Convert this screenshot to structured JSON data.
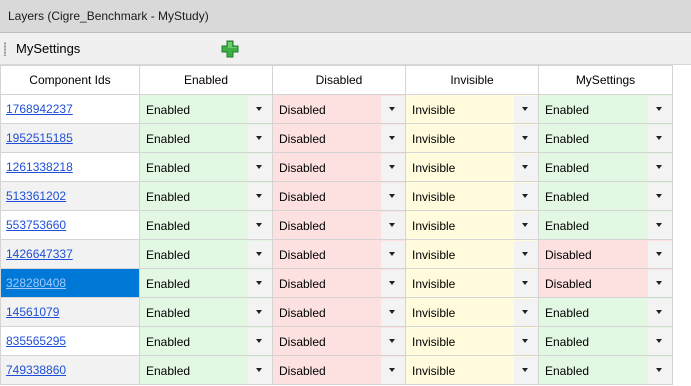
{
  "window": {
    "title": "Layers (Cigre_Benchmark - MyStudy)"
  },
  "toolbar": {
    "layer_name": "MySettings",
    "add_icon": "green-plus-icon",
    "add_color": "#3cb043"
  },
  "grid": {
    "columns": [
      "Component Ids",
      "Enabled",
      "Disabled",
      "Invisible",
      "MySettings"
    ],
    "selected_row": 6,
    "rows": [
      {
        "id": "1768942237",
        "enabled": "Enabled",
        "disabled": "Disabled",
        "invisible": "Invisible",
        "mysettings": "Enabled"
      },
      {
        "id": "1952515185",
        "enabled": "Enabled",
        "disabled": "Disabled",
        "invisible": "Invisible",
        "mysettings": "Enabled"
      },
      {
        "id": "1261338218",
        "enabled": "Enabled",
        "disabled": "Disabled",
        "invisible": "Invisible",
        "mysettings": "Enabled"
      },
      {
        "id": "513361202",
        "enabled": "Enabled",
        "disabled": "Disabled",
        "invisible": "Invisible",
        "mysettings": "Enabled"
      },
      {
        "id": "553753660",
        "enabled": "Enabled",
        "disabled": "Disabled",
        "invisible": "Invisible",
        "mysettings": "Enabled"
      },
      {
        "id": "1426647337",
        "enabled": "Enabled",
        "disabled": "Disabled",
        "invisible": "Invisible",
        "mysettings": "Disabled"
      },
      {
        "id": "328280408",
        "enabled": "Enabled",
        "disabled": "Disabled",
        "invisible": "Invisible",
        "mysettings": "Disabled"
      },
      {
        "id": "14561079",
        "enabled": "Enabled",
        "disabled": "Disabled",
        "invisible": "Invisible",
        "mysettings": "Enabled"
      },
      {
        "id": "835565295",
        "enabled": "Enabled",
        "disabled": "Disabled",
        "invisible": "Invisible",
        "mysettings": "Enabled"
      },
      {
        "id": "749338860",
        "enabled": "Enabled",
        "disabled": "Disabled",
        "invisible": "Invisible",
        "mysettings": "Enabled"
      }
    ]
  },
  "colors": {
    "enabled_cell": "#e3f8e3",
    "disabled_cell": "#fde0e0",
    "invisible_cell": "#fffbdc",
    "selection": "#0078d7"
  }
}
